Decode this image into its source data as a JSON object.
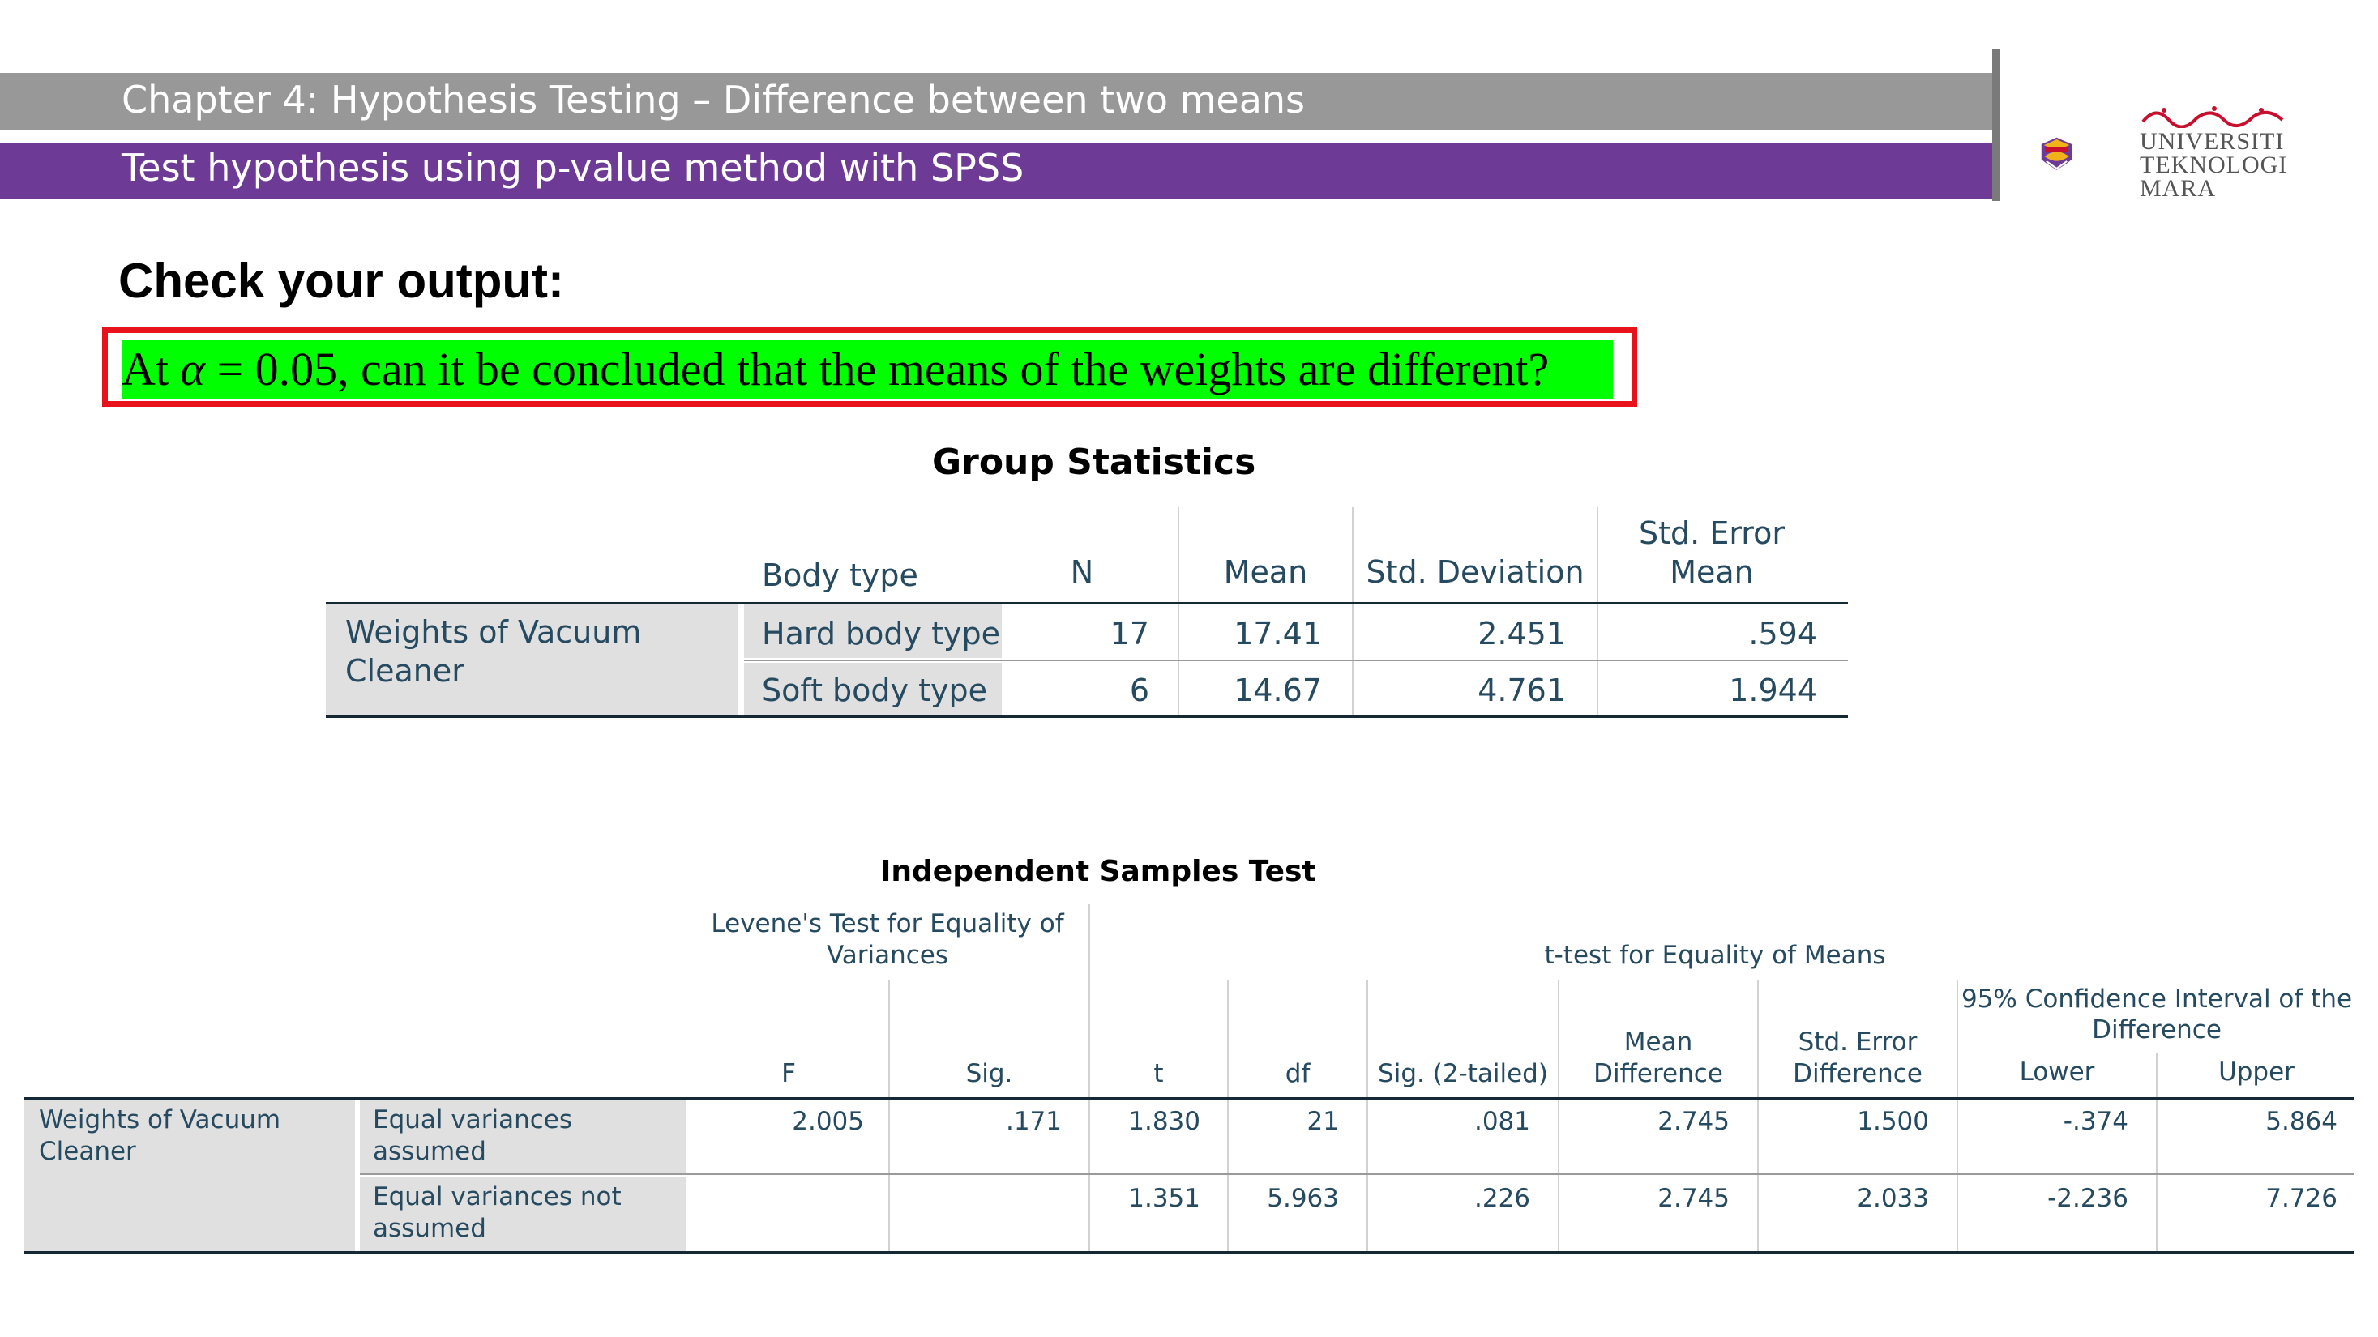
{
  "header": {
    "chapter_title": "Chapter 4: Hypothesis Testing – Difference between two means",
    "subtitle": "Test hypothesis using p-value method with SPSS"
  },
  "logo": {
    "line1": "UNIVERSITI",
    "line2": "TEKNOLOGI",
    "line3": "MARA",
    "icon": "uitm-crest-icon",
    "brand_colors": [
      "#6d3a96",
      "#f2b21a",
      "#c8102e"
    ]
  },
  "main": {
    "heading": "Check your output:",
    "question_pre": "At ",
    "question_alpha": "α",
    "question_post": " = 0.05, can it be concluded that the means of the weights are different?",
    "highlight_color": "#00ff00",
    "box_color": "#e8121b"
  },
  "group_stats": {
    "title": "Group Statistics",
    "headers": {
      "body_type": "Body type",
      "n": "N",
      "mean": "Mean",
      "std_dev": "Std. Deviation",
      "se_line1": "Std. Error",
      "se_line2": "Mean"
    },
    "variable_line1": "Weights of Vacuum",
    "variable_line2": "Cleaner",
    "rows": [
      {
        "group": "Hard body type",
        "n": "17",
        "mean": "17.41",
        "sd": "2.451",
        "se": ".594"
      },
      {
        "group": "Soft body type",
        "n": "6",
        "mean": "14.67",
        "sd": "4.761",
        "se": "1.944"
      }
    ]
  },
  "ind_test": {
    "title": "Independent Samples Test",
    "levene_line1": "Levene's Test for Equality of",
    "levene_line2": "Variances",
    "ttest_header": "t-test for Equality of Means",
    "ci_line1": "95% Confidence Interval of the",
    "ci_line2": "Difference",
    "cols": {
      "f": "F",
      "sig": "Sig.",
      "t": "t",
      "df": "df",
      "sig2": "Sig. (2-tailed)",
      "md_line1": "Mean",
      "md_line2": "Difference",
      "sed_line1": "Std. Error",
      "sed_line2": "Difference",
      "lower": "Lower",
      "upper": "Upper"
    },
    "variable_line1": "Weights of Vacuum",
    "variable_line2": "Cleaner",
    "rows": [
      {
        "label_line1": "Equal variances",
        "label_line2": "assumed",
        "f": "2.005",
        "sig": ".171",
        "t": "1.830",
        "df": "21",
        "sig2": ".081",
        "md": "2.745",
        "sed": "1.500",
        "lower": "-.374",
        "upper": "5.864"
      },
      {
        "label_line1": "Equal variances not",
        "label_line2": "assumed",
        "f": "",
        "sig": "",
        "t": "1.351",
        "df": "5.963",
        "sig2": ".226",
        "md": "2.745",
        "sed": "2.033",
        "lower": "-2.236",
        "upper": "7.726"
      }
    ]
  }
}
